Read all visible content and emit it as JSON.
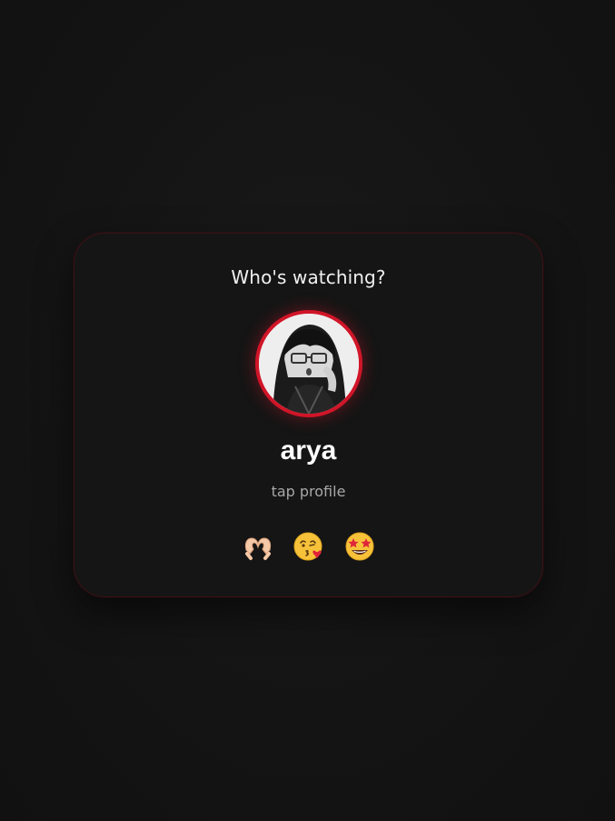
{
  "dialog": {
    "title": "Who's watching?",
    "profile": {
      "name": "arya",
      "hint": "tap profile",
      "accent_color": "#d11528"
    },
    "reactions": [
      {
        "icon": "heart-hands-icon",
        "glyph": "🫶"
      },
      {
        "icon": "face-blowing-kiss-icon",
        "glyph": "😘"
      },
      {
        "icon": "star-struck-icon",
        "glyph": "🤩"
      }
    ]
  },
  "colors": {
    "background": "#121212",
    "card": "#151515",
    "card_border": "#3a1116",
    "text_primary": "#ffffff",
    "text_secondary": "#a8a8a8"
  }
}
